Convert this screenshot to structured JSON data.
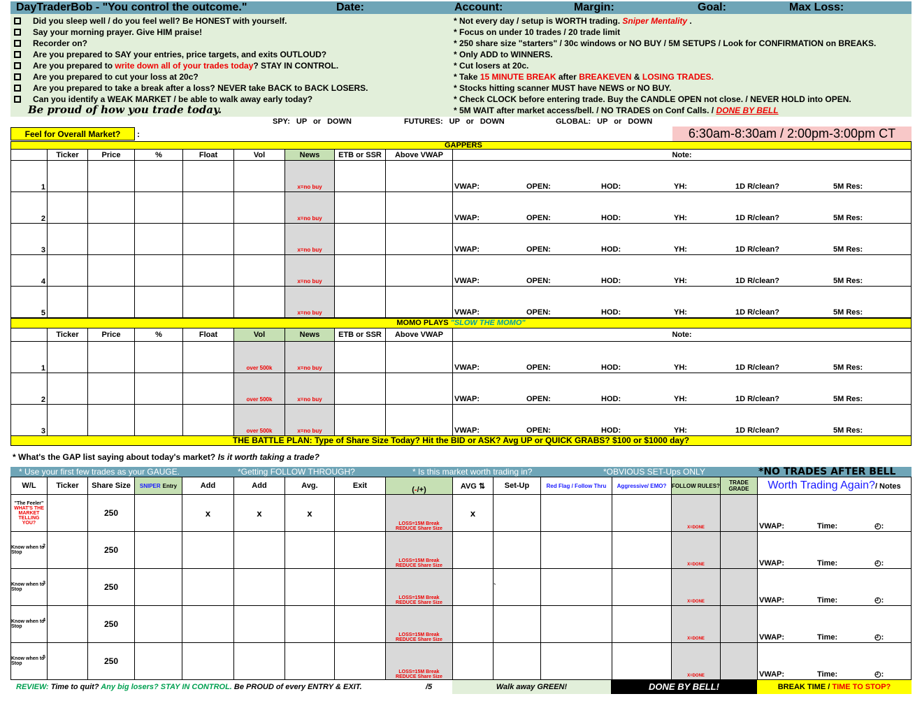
{
  "header": {
    "title": "DayTraderBob - \"You control the outcome.\"",
    "date": "Date:",
    "account": "Account:",
    "margin": "Margin:",
    "goal": "Goal:",
    "max_loss": "Max Loss:"
  },
  "checklist": [
    {
      "parts": [
        "Did you sleep well / do you feel well? Be HONEST with yourself."
      ]
    },
    {
      "parts": [
        "Say your morning prayer. Give HIM praise!"
      ]
    },
    {
      "parts": [
        "Recorder on?"
      ]
    },
    {
      "parts": [
        "Are you prepared to SAY your entries, price targets, and exits OUTLOUD?"
      ]
    },
    {
      "parts": [
        "Are you prepared to ",
        "write down all of your trades today",
        "? STAY IN CONTROL."
      ]
    },
    {
      "parts": [
        "Are you prepared to cut your loss at 20c?"
      ]
    },
    {
      "parts": [
        "Are you prepared to take a break after a loss? NEVER take BACK to BACK LOSERS."
      ]
    },
    {
      "parts": [
        "Can you identify a WEAK MARKET / be able to walk away early today?"
      ]
    }
  ],
  "motto": "Be proud of how you trade today.",
  "rules": [
    {
      "parts": [
        "* Not every day / setup is WORTH trading.  ",
        "Sniper Mentality",
        " ."
      ]
    },
    {
      "parts": [
        "* Focus on under 10 trades / 20 trade limit"
      ]
    },
    {
      "parts": [
        "* 250 share size \"starters\" / 30c windows or NO BUY / 5M SETUPS / Look for CONFIRMATION on BREAKS."
      ]
    },
    {
      "parts": [
        "* Only ADD to WINNERS."
      ]
    },
    {
      "parts": [
        "* Cut losers at 20c."
      ]
    },
    {
      "parts": [
        "* Take ",
        "15 MINUTE BREAK",
        " after ",
        "BREAKEVEN",
        " & ",
        "LOSING TRADES."
      ]
    },
    {
      "parts": [
        "* Stocks hitting scanner MUST have NEWS or NO BUY."
      ]
    },
    {
      "parts": [
        "* Check CLOCK before entering trade. Buy the CANDLE OPEN not close. / NEVER HOLD into OPEN."
      ]
    },
    {
      "parts": [
        "* 5M WAIT after market access/bell. / NO TRADES on Conf Calls. / ",
        "DONE BY BELL"
      ]
    }
  ],
  "markets": {
    "spy": "SPY:  UP  or  DOWN",
    "futures": "FUTURES:  UP  or  DOWN",
    "global": "GLOBAL:  UP  or  DOWN"
  },
  "feel": {
    "label": "Feel for Overall Market?",
    "colon": ":"
  },
  "hours": "6:30am-8:30am / 2:00pm-3:00pm CT",
  "gappers": {
    "title": "GAPPERS",
    "columns": [
      "",
      "Ticker",
      "Price",
      "%",
      "Float",
      "Vol",
      "News",
      "ETB or SSR",
      "Above VWAP",
      "Note:"
    ],
    "news_hint": "x=no buy",
    "rows": [
      "1",
      "2",
      "3",
      "4",
      "5"
    ]
  },
  "note_fields": [
    "VWAP:",
    "OPEN:",
    "HOD:",
    "YH:",
    "1D R/clean?",
    "5M Res:"
  ],
  "momo": {
    "title": "MOMO PLAYS ",
    "subtitle": "\"SLOW THE MOMO\"",
    "columns": [
      "",
      "Ticker",
      "Price",
      "%",
      "Float",
      "Vol",
      "News",
      "ETB or SSR",
      "Above VWAP",
      "Note:"
    ],
    "vol_hint": "over 500k",
    "news_hint": "x=no buy",
    "rows": [
      "1",
      "2",
      "3"
    ]
  },
  "battle_plan": "THE BATTLE PLAN: Type of Share Size Today? Hit the BID or ASK? Avg UP or QUICK GRABS? $100 or $1000 day?",
  "gap_question": {
    "text": "* What's the GAP list saying about today's market? ",
    "italic": "Is it worth taking a trade?"
  },
  "trade_bar": [
    "* Use your first few trades as your GAUGE.",
    "*Getting FOLLOW THROUGH?",
    "* Is this market worth trading in?",
    "*OBVIOUS SET-Ups ONLY",
    "*NO TRADES AFTER BELL"
  ],
  "trades": {
    "columns": [
      "W/L",
      "Ticker",
      "Share Size",
      "SNIPER",
      "Entry",
      "Add",
      "Add",
      "Avg.",
      "Exit",
      "(",
      "-",
      "/+)",
      "AVG ⇅",
      "Set-Up",
      "Red Flag / Follow Thru",
      "Aggressive/ EMO?",
      "FOLLOW RULES?",
      "TRADE GRADE",
      "Worth Trading Again?",
      "/ Notes"
    ],
    "first_row": {
      "wl": [
        "\"The Feeler\"",
        "WHAT'S THE MARKET TELLING YOU?"
      ],
      "share": "250",
      "marks": [
        "x",
        "x",
        "x",
        "x"
      ]
    },
    "rows": [
      {
        "wl": "Know when to Stop",
        "n": "2",
        "share": "250"
      },
      {
        "wl": "Know when to Stop",
        "n": "3",
        "share": "250"
      },
      {
        "wl": "Know when to Stop",
        "n": "4",
        "share": "250"
      },
      {
        "wl": "Know when to Stop",
        "n": "5",
        "share": "250"
      }
    ],
    "loss_hint": [
      "LOSS=15M Break",
      "REDUCE Share Size"
    ],
    "done_hint": "X=DONE",
    "stray_mark": "`",
    "notes": [
      "VWAP:",
      "Time:",
      "◴:"
    ]
  },
  "footer": {
    "review": "REVIEW:",
    "q1": " Time to quit? ",
    "q2": "Any big losers? STAY IN CONTROL.",
    "q3": "  Be PROUD of every ENTRY & EXIT.",
    "score": "/5",
    "walk": "Walk away GREEN!",
    "done": "DONE BY BELL!",
    "break": "BREAK TIME / ",
    "stop": "TIME TO STOP?"
  },
  "colors": {
    "header_blue": "#6fa5b7",
    "panel_green": "#e2efda",
    "yellow": "#ffff00",
    "pink": "#f8c8c8",
    "red": "#ee0000",
    "blue": "#1a1aff",
    "gray": "#d9d9d9"
  }
}
